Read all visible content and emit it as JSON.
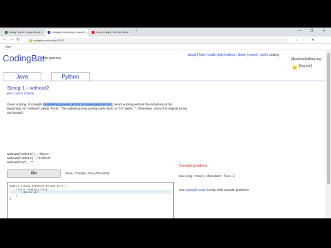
{
  "browser": {
    "tabs": [
      {
        "label": "Coding Tutorial - Google Sheets",
        "favicon_color": "#1e8e3e",
        "active": false
      },
      {
        "label": "CodingBat Java String-1 without2",
        "favicon_color": "#3344aa",
        "active": true
      },
      {
        "label": "Voice of Calling - YouTube Studio",
        "favicon_color": "#ff0000",
        "active": false
      }
    ],
    "new_tab_glyph": "+",
    "window_controls": "— ❐ ✕",
    "url": "codingbat.com/prob/p142247",
    "bookmarks_label": "Apps"
  },
  "site": {
    "logo": "CodingBat",
    "logo_sub": "code practice",
    "links": [
      "about",
      "help",
      "code help+videos",
      "done",
      "report",
      "prefs"
    ],
    "site_name": "coding",
    "user": "@voiceofcalling.org",
    "logout": "[log out]",
    "language_tabs": [
      "Java",
      "Python"
    ]
  },
  "problem": {
    "category": "String-1",
    "separator": ">",
    "name": "without2",
    "subnav": [
      "prev",
      "next",
      "chance"
    ],
    "desc_before": "Given a string, if a length ",
    "desc_highlight": "2 substring appears at both its beginning and end",
    "desc_after": ", return a string without the substring at the beginning, so \"HelloHe\" yields \"lloHe\". The substring may overlap with itself, so \"Hi\" yields \"\". Otherwise, return the original string unchanged.",
    "examples": [
      "without2(\"HelloHe\") → \"lloHe\"",
      "without2(\"HelloHi\") → \"HelloHi\"",
      "without2(\"Hi\") → \"\""
    ],
    "go_label": "Go",
    "go_hint": "...Save, Compile, Run (ctrl-enter)"
  },
  "editor": {
    "lines": [
      "public String without2(String str) {",
      "    if(str.length()>=2){",
      "        return str;",
      "    }",
      "}"
    ],
    "cursor_line": 2
  },
  "compile": {
    "header": "Compile problems:",
    "error": "missing return statement line:3",
    "help_before": "see ",
    "help_link": "Example Code",
    "help_after": " to help with compile problems"
  },
  "video_controls": [
    "▮",
    "⚙",
    "▭",
    "⛶"
  ]
}
